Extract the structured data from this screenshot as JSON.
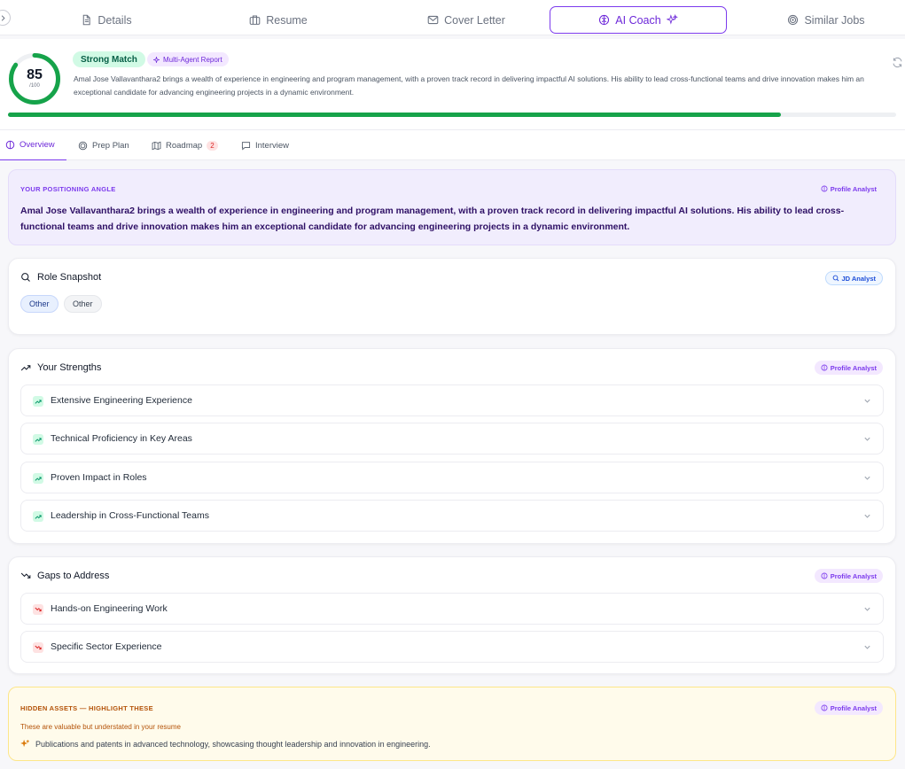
{
  "tabs": [
    {
      "label": "Details",
      "icon": "document-icon"
    },
    {
      "label": "Resume",
      "icon": "briefcase-icon"
    },
    {
      "label": "Cover Letter",
      "icon": "mail-icon"
    },
    {
      "label": "AI Coach",
      "icon": "brain-icon",
      "active": true
    },
    {
      "label": "Similar Jobs",
      "icon": "target-icon"
    }
  ],
  "score": {
    "value": "85",
    "denominator": "/100",
    "fraction": 0.85,
    "progress_fraction": 0.87,
    "match_label": "Strong Match",
    "report_label": "Multi-Agent Report",
    "summary": "Amal Jose Vallavanthara2 brings a wealth of experience in engineering and program management, with a proven track record in delivering impactful AI solutions. His ability to lead cross-functional teams and drive innovation makes him an exceptional candidate for advancing engineering projects in a dynamic environment."
  },
  "subtabs": [
    {
      "label": "Overview",
      "icon": "brain-icon",
      "active": true
    },
    {
      "label": "Prep Plan",
      "icon": "target-icon"
    },
    {
      "label": "Roadmap",
      "icon": "map-icon",
      "badge": "2"
    },
    {
      "label": "Interview",
      "icon": "chat-icon"
    }
  ],
  "positioning": {
    "title": "YOUR POSITIONING ANGLE",
    "agent": "Profile Analyst",
    "text": "Amal Jose Vallavanthara2 brings a wealth of experience in engineering and program management, with a proven track record in delivering impactful AI solutions. His ability to lead cross-functional teams and drive innovation makes him an exceptional candidate for advancing engineering projects in a dynamic environment."
  },
  "role_snapshot": {
    "title": "Role Snapshot",
    "agent": "JD Analyst",
    "pills": [
      "Other",
      "Other"
    ]
  },
  "strengths": {
    "title": "Your Strengths",
    "agent": "Profile Analyst",
    "items": [
      "Extensive Engineering Experience",
      "Technical Proficiency in Key Areas",
      "Proven Impact in Roles",
      "Leadership in Cross-Functional Teams"
    ]
  },
  "gaps": {
    "title": "Gaps to Address",
    "agent": "Profile Analyst",
    "items": [
      "Hands-on Engineering Work",
      "Specific Sector Experience"
    ]
  },
  "hidden_assets": {
    "title": "HIDDEN ASSETS — HIGHLIGHT THESE",
    "agent": "Profile Analyst",
    "subtitle": "These are valuable but understated in your resume",
    "items": [
      "Publications and patents in advanced technology, showcasing thought leadership and innovation in engineering."
    ]
  },
  "colors": {
    "accent": "#7c3aed",
    "success": "#16a34a",
    "danger": "#dc2626",
    "warning": "#b45309"
  }
}
